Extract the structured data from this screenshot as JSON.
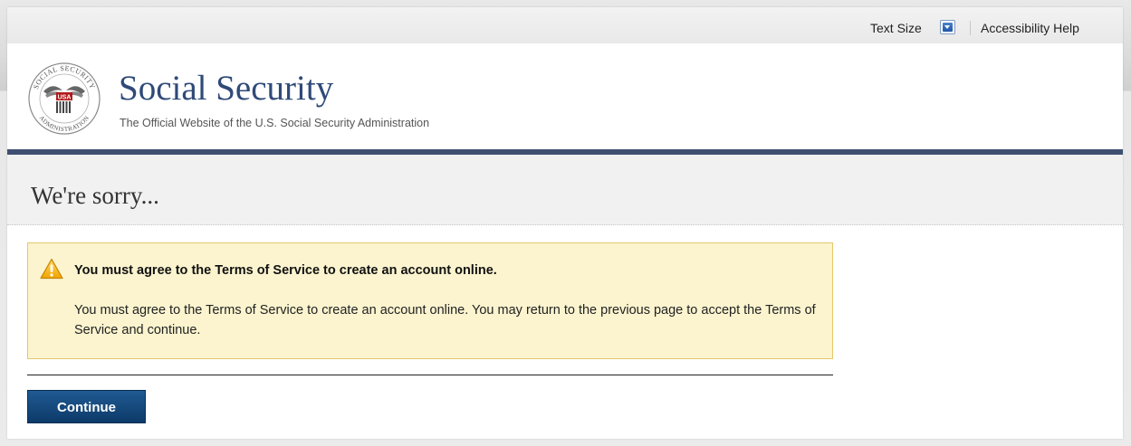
{
  "utility_bar": {
    "text_size_label": "Text Size",
    "text_size_icon": "chevron-down-icon",
    "accessibility_help": "Accessibility Help"
  },
  "header": {
    "logo_icon": "ssa-seal-icon",
    "seal_text_top": "SOCIAL SECURITY",
    "seal_text_bottom": "ADMINISTRATION",
    "seal_usa": "USA",
    "title": "Social Security",
    "tagline": "The Official Website of the U.S. Social Security Administration",
    "rule_color": "#3f4f72"
  },
  "main": {
    "page_title": "We're sorry...",
    "alert": {
      "icon": "warning-icon",
      "title": "You must agree to the Terms of Service to create an account online.",
      "body": "You must agree to the Terms of Service to create an account online. You may return to the previous page to accept the Terms of Service and continue.",
      "background_color": "#fbf4cf",
      "border_color": "#e5c76b"
    },
    "continue_label": "Continue",
    "continue_color": "#1a4f85"
  }
}
